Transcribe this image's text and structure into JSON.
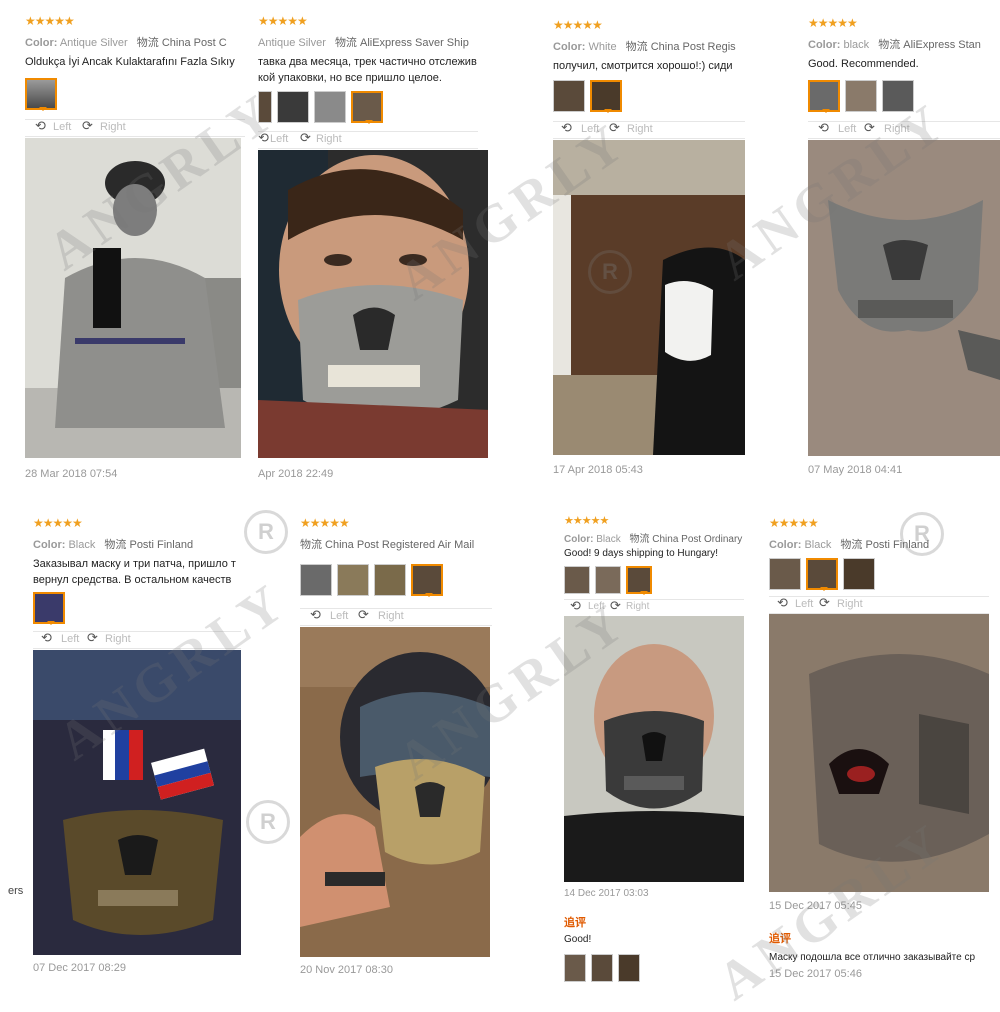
{
  "rating": "★★★★★",
  "color_label": "Color:",
  "rotate": {
    "left": "Left",
    "right": "Right"
  },
  "reviews": [
    {
      "color": "Antique Silver",
      "shipping": "物流 China Post C",
      "comment": "Oldukça İyi Ancak Kulaktarafını Fazla Sıkıy",
      "date": "28 Mar 2018 07:54"
    },
    {
      "color": "Antique Silver",
      "shipping": "物流 AliExpress Saver Ship",
      "comment": "тавка два месяца, трек частично отслежив",
      "comment2": "кой упаковки, но все пришло целое.",
      "date": "Apr 2018 22:49"
    },
    {
      "color": "White",
      "shipping": "物流 China Post Regis",
      "comment": "получил, смотрится хорошо!:) сиди",
      "date": "17 Apr 2018 05:43"
    },
    {
      "color": "black",
      "shipping": "物流 AliExpress Stan",
      "comment": "Good. Recommended.",
      "date": "07 May 2018 04:41"
    },
    {
      "color": "Black",
      "shipping": "物流 Posti Finland",
      "comment": "Заказывал маску и три патча, пришло т",
      "comment2": "вернул средства. В остальном качеств",
      "date": "07 Dec 2017 08:29"
    },
    {
      "color": "",
      "shipping": "物流 China Post Registered Air Mail",
      "comment": "",
      "date": "20 Nov 2017 08:30"
    },
    {
      "color": "Black",
      "shipping": "物流 China Post Ordinary S",
      "comment": "Good! 9 days shipping to Hungary!",
      "date": "14 Dec 2017 03:03",
      "additional_label": "追评",
      "additional_text": "Good!"
    },
    {
      "color": "Black",
      "shipping": "物流 Posti Finland",
      "comment": "",
      "date": "15 Dec 2017 05:45",
      "additional_label": "追评",
      "additional_text": "Маску подошла все отлично заказывайте ср",
      "additional_date": "15 Dec 2017 05:46"
    }
  ],
  "stray_text": "ers",
  "watermark": "ANGRLY",
  "reg_mark": "R"
}
